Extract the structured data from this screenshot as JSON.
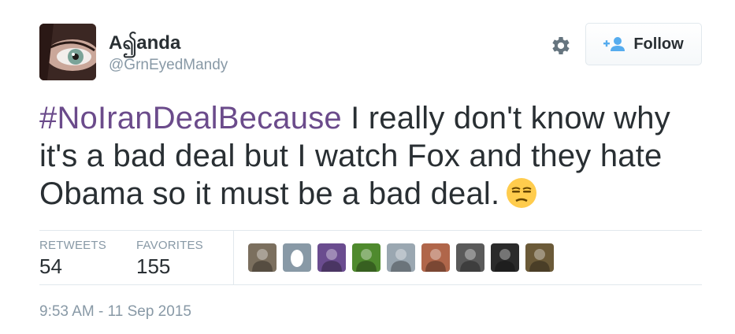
{
  "user": {
    "display_name": "A၍anda",
    "handle": "@GrnEyedMandy"
  },
  "actions": {
    "follow_label": "Follow",
    "settings_icon": "gear-icon",
    "follow_icon": "add-user-icon"
  },
  "tweet": {
    "hashtag": "#NoIranDealBecause",
    "body": " I really don't know why it's a bad deal but I watch Fox and they hate Obama so it must be a bad deal.",
    "emoji": "unamused-face-emoji"
  },
  "stats": {
    "retweets_label": "RETWEETS",
    "retweets_value": "54",
    "favorites_label": "FAVORITES",
    "favorites_value": "155"
  },
  "favoriters": [
    {
      "icon": "user-avatar",
      "color": "#7b6f5e"
    },
    {
      "icon": "default-egg-avatar",
      "color": "#8899a6"
    },
    {
      "icon": "user-avatar",
      "color": "#6a4c8f"
    },
    {
      "icon": "user-avatar",
      "color": "#4f8a2e"
    },
    {
      "icon": "user-avatar",
      "color": "#9aa7b1"
    },
    {
      "icon": "user-avatar",
      "color": "#b0664a"
    },
    {
      "icon": "user-avatar",
      "color": "#5a5a5a"
    },
    {
      "icon": "user-avatar",
      "color": "#2b2b2b"
    },
    {
      "icon": "user-avatar",
      "color": "#6b5a38"
    }
  ],
  "timestamp": "9:53 AM - 11 Sep 2015",
  "colors": {
    "text": "#292f33",
    "muted": "#8899a6",
    "hashtag": "#6b4b8b",
    "follow_icon": "#55acee",
    "border": "#e1e8ed"
  }
}
